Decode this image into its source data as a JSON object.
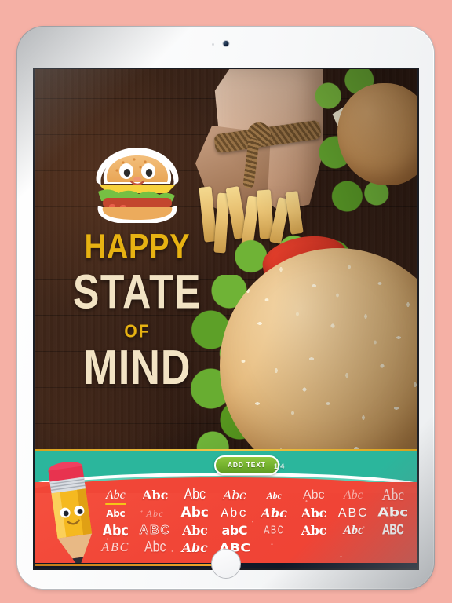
{
  "device": {
    "type": "tablet-mockup",
    "frame_color": "#f5f6f7",
    "background_color": "#f5b0a5"
  },
  "poster": {
    "mascot": "burger-mascot",
    "lines": [
      {
        "text": "HAPPY",
        "color": "#e7b212"
      },
      {
        "text": "STATE",
        "color": "#f2e3c4"
      },
      {
        "text": "OF",
        "color": "#e7b212"
      },
      {
        "text": "MIND",
        "color": "#f2e3c4"
      }
    ]
  },
  "toolbar": {
    "add_text_label": "ADD TEXT",
    "page_indicator": "1/4",
    "button_color": "#76b32f",
    "band_color": "#2bb69c",
    "accent_gold": "#d8a11d"
  },
  "font_picker": {
    "mascot": "pencil-mascot",
    "panel_color": "#f14637",
    "selected_index": 0,
    "selected_underline_color": "#f5c518",
    "columns": 8,
    "rows": 4,
    "samples": [
      {
        "label": "Abc",
        "style": "f-serif f-i f-lg"
      },
      {
        "label": "Abc",
        "style": "f-dserif f-b f-lg"
      },
      {
        "label": "Abc",
        "style": "f-sans f-lg f-tall"
      },
      {
        "label": "Abc",
        "style": "f-dserif f-i f-lg f-tight"
      },
      {
        "label": "Abc",
        "style": "f-serif f-b f-i f-sm"
      },
      {
        "label": "Abc",
        "style": "f-sans f-thin f-lg"
      },
      {
        "label": "Abc",
        "style": "f-serif f-i f-faint f-lg"
      },
      {
        "label": "Abc",
        "style": "f-serif f-thin f-xlg f-tall"
      },
      {
        "label": "Abc",
        "style": "f-dsans f-b f-sm f-tight"
      },
      {
        "label": "Abc",
        "style": "f-serif f-i f-faint f-sm f-wide"
      },
      {
        "label": "Abc",
        "style": "f-dsans f-b f-xlg"
      },
      {
        "label": "Abc",
        "style": "f-mono f-lg f-wide"
      },
      {
        "label": "Abc",
        "style": "f-dserif f-b f-i f-lg"
      },
      {
        "label": "Abc",
        "style": "f-dserif f-b f-lg f-tight"
      },
      {
        "label": "ABC",
        "style": "f-sans f-lg f-wide"
      },
      {
        "label": "Abc",
        "style": "f-dsans f-b f-xlg f-squat"
      },
      {
        "label": "Abc",
        "style": "f-dsans f-b f-lg f-tall"
      },
      {
        "label": "ABC",
        "style": "f-out f-lg f-b f-wide"
      },
      {
        "label": "Abc",
        "style": "f-dserif f-b f-lg f-tight"
      },
      {
        "label": "abC",
        "style": "f-dsans f-b f-lg f-tight"
      },
      {
        "label": "ABC",
        "style": "f-mono f-sm f-thin f-wide f-tall"
      },
      {
        "label": "Abc",
        "style": "f-dserif f-b f-lg f-tight"
      },
      {
        "label": "Abc",
        "style": "f-serif f-i f-b f-lg"
      },
      {
        "label": "ABC",
        "style": "f-mono f-b f-lg f-tall f-tight"
      },
      {
        "label": "ABC",
        "style": "f-serif f-i f-thin f-lg f-wide"
      },
      {
        "label": "Abc",
        "style": "f-sans f-thin f-lg f-tall"
      },
      {
        "label": "Abc",
        "style": "f-dserif f-b f-i f-lg"
      },
      {
        "label": "ABC",
        "style": "f-dsans f-b f-lg f-squat"
      }
    ]
  },
  "progress": {
    "value_percent": 48,
    "track_color": "#111827",
    "fill_color": "#f0a62a"
  }
}
